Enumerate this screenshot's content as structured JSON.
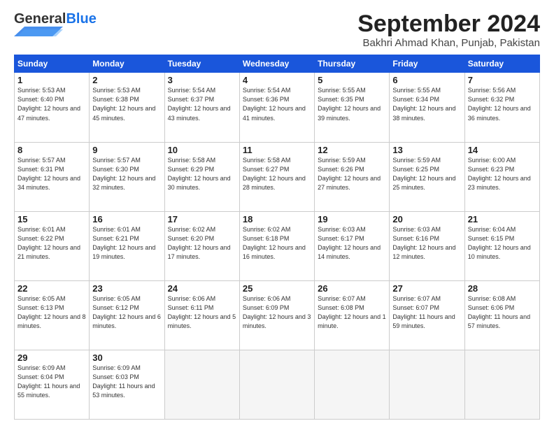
{
  "header": {
    "logo_general": "General",
    "logo_blue": "Blue",
    "month_year": "September 2024",
    "location": "Bakhri Ahmad Khan, Punjab, Pakistan"
  },
  "days_of_week": [
    "Sunday",
    "Monday",
    "Tuesday",
    "Wednesday",
    "Thursday",
    "Friday",
    "Saturday"
  ],
  "weeks": [
    [
      {
        "day": "1",
        "sunrise": "5:53 AM",
        "sunset": "6:40 PM",
        "daylight": "12 hours and 47 minutes."
      },
      {
        "day": "2",
        "sunrise": "5:53 AM",
        "sunset": "6:38 PM",
        "daylight": "12 hours and 45 minutes."
      },
      {
        "day": "3",
        "sunrise": "5:54 AM",
        "sunset": "6:37 PM",
        "daylight": "12 hours and 43 minutes."
      },
      {
        "day": "4",
        "sunrise": "5:54 AM",
        "sunset": "6:36 PM",
        "daylight": "12 hours and 41 minutes."
      },
      {
        "day": "5",
        "sunrise": "5:55 AM",
        "sunset": "6:35 PM",
        "daylight": "12 hours and 39 minutes."
      },
      {
        "day": "6",
        "sunrise": "5:55 AM",
        "sunset": "6:34 PM",
        "daylight": "12 hours and 38 minutes."
      },
      {
        "day": "7",
        "sunrise": "5:56 AM",
        "sunset": "6:32 PM",
        "daylight": "12 hours and 36 minutes."
      }
    ],
    [
      {
        "day": "8",
        "sunrise": "5:57 AM",
        "sunset": "6:31 PM",
        "daylight": "12 hours and 34 minutes."
      },
      {
        "day": "9",
        "sunrise": "5:57 AM",
        "sunset": "6:30 PM",
        "daylight": "12 hours and 32 minutes."
      },
      {
        "day": "10",
        "sunrise": "5:58 AM",
        "sunset": "6:29 PM",
        "daylight": "12 hours and 30 minutes."
      },
      {
        "day": "11",
        "sunrise": "5:58 AM",
        "sunset": "6:27 PM",
        "daylight": "12 hours and 28 minutes."
      },
      {
        "day": "12",
        "sunrise": "5:59 AM",
        "sunset": "6:26 PM",
        "daylight": "12 hours and 27 minutes."
      },
      {
        "day": "13",
        "sunrise": "5:59 AM",
        "sunset": "6:25 PM",
        "daylight": "12 hours and 25 minutes."
      },
      {
        "day": "14",
        "sunrise": "6:00 AM",
        "sunset": "6:23 PM",
        "daylight": "12 hours and 23 minutes."
      }
    ],
    [
      {
        "day": "15",
        "sunrise": "6:01 AM",
        "sunset": "6:22 PM",
        "daylight": "12 hours and 21 minutes."
      },
      {
        "day": "16",
        "sunrise": "6:01 AM",
        "sunset": "6:21 PM",
        "daylight": "12 hours and 19 minutes."
      },
      {
        "day": "17",
        "sunrise": "6:02 AM",
        "sunset": "6:20 PM",
        "daylight": "12 hours and 17 minutes."
      },
      {
        "day": "18",
        "sunrise": "6:02 AM",
        "sunset": "6:18 PM",
        "daylight": "12 hours and 16 minutes."
      },
      {
        "day": "19",
        "sunrise": "6:03 AM",
        "sunset": "6:17 PM",
        "daylight": "12 hours and 14 minutes."
      },
      {
        "day": "20",
        "sunrise": "6:03 AM",
        "sunset": "6:16 PM",
        "daylight": "12 hours and 12 minutes."
      },
      {
        "day": "21",
        "sunrise": "6:04 AM",
        "sunset": "6:15 PM",
        "daylight": "12 hours and 10 minutes."
      }
    ],
    [
      {
        "day": "22",
        "sunrise": "6:05 AM",
        "sunset": "6:13 PM",
        "daylight": "12 hours and 8 minutes."
      },
      {
        "day": "23",
        "sunrise": "6:05 AM",
        "sunset": "6:12 PM",
        "daylight": "12 hours and 6 minutes."
      },
      {
        "day": "24",
        "sunrise": "6:06 AM",
        "sunset": "6:11 PM",
        "daylight": "12 hours and 5 minutes."
      },
      {
        "day": "25",
        "sunrise": "6:06 AM",
        "sunset": "6:09 PM",
        "daylight": "12 hours and 3 minutes."
      },
      {
        "day": "26",
        "sunrise": "6:07 AM",
        "sunset": "6:08 PM",
        "daylight": "12 hours and 1 minute."
      },
      {
        "day": "27",
        "sunrise": "6:07 AM",
        "sunset": "6:07 PM",
        "daylight": "11 hours and 59 minutes."
      },
      {
        "day": "28",
        "sunrise": "6:08 AM",
        "sunset": "6:06 PM",
        "daylight": "11 hours and 57 minutes."
      }
    ],
    [
      {
        "day": "29",
        "sunrise": "6:09 AM",
        "sunset": "6:04 PM",
        "daylight": "11 hours and 55 minutes."
      },
      {
        "day": "30",
        "sunrise": "6:09 AM",
        "sunset": "6:03 PM",
        "daylight": "11 hours and 53 minutes."
      },
      null,
      null,
      null,
      null,
      null
    ]
  ]
}
